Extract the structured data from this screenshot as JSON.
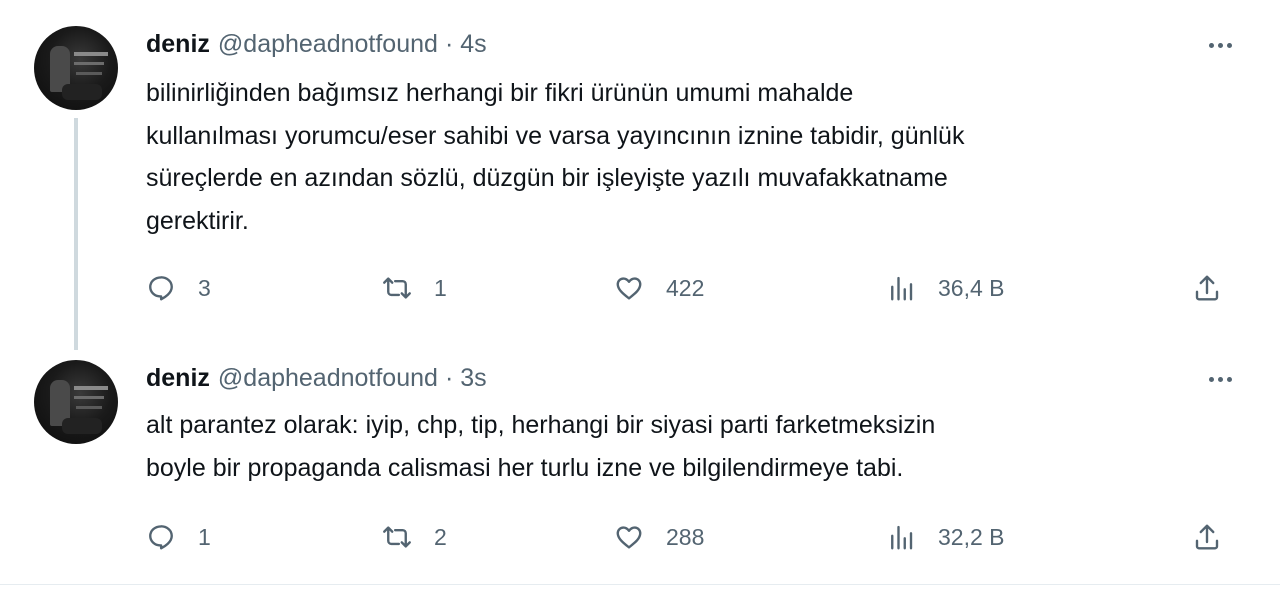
{
  "tweets": [
    {
      "author_name": "deniz",
      "handle": "@dapheadnotfound",
      "separator": "·",
      "time": "4s",
      "text": "bilinirliğinden bağımsız herhangi bir fikri ürünün umumi mahalde\nkullanılması yorumcu/eser sahibi ve varsa yayıncının iznine tabidir, günlük\nsüreçlerde en azından sözlü, düzgün bir işleyişte yazılı muvafakkatname\ngerektirir.",
      "replies": "3",
      "retweets": "1",
      "likes": "422",
      "views": "36,4 B"
    },
    {
      "author_name": "deniz",
      "handle": "@dapheadnotfound",
      "separator": "·",
      "time": "3s",
      "text": "alt parantez olarak: iyip, chp, tip, herhangi bir siyasi parti farketmeksizin\nboyle bir propaganda calismasi her turlu izne ve bilgilendirmeye tabi.",
      "replies": "1",
      "retweets": "2",
      "likes": "288",
      "views": "32,2 B"
    }
  ],
  "icons": {
    "reply": "reply-icon",
    "retweet": "retweet-icon",
    "like": "heart-icon",
    "views": "views-icon",
    "share": "share-icon",
    "more": "more-options-icon"
  }
}
